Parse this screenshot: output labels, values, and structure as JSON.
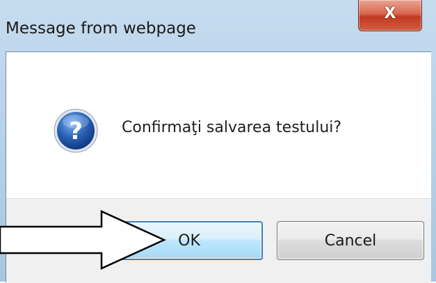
{
  "dialog": {
    "title": "Message from webpage",
    "close_glyph": "X",
    "message": "Confirmaţi salvarea testului?",
    "icon": "question-icon",
    "ok_label": "OK",
    "cancel_label": "Cancel"
  },
  "colors": {
    "titlebar": "#b5cfe6",
    "close_button": "#c7432b",
    "question_icon": "#1f4f9a",
    "button_bar": "#f0f0f0",
    "ok_border": "#3c7fb1"
  }
}
